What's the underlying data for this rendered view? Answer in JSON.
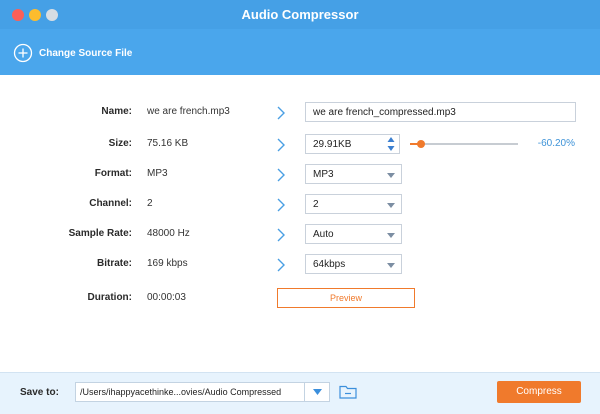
{
  "window": {
    "title": "Audio Compressor"
  },
  "toolbar": {
    "change_source_label": "Change Source File"
  },
  "colors": {
    "accent": "#45a0e6",
    "action": "#f07a2c"
  },
  "fields": {
    "name": {
      "label": "Name:",
      "original": "we are french.mp3",
      "output": "we are french_compressed.mp3"
    },
    "size": {
      "label": "Size:",
      "original": "75.16 KB",
      "output": "29.91KB",
      "percent": "-60.20%",
      "slider_fraction": 0.1
    },
    "format": {
      "label": "Format:",
      "original": "MP3",
      "selected": "MP3"
    },
    "channel": {
      "label": "Channel:",
      "original": "2",
      "selected": "2"
    },
    "sample_rate": {
      "label": "Sample Rate:",
      "original": "48000 Hz",
      "selected": "Auto"
    },
    "bitrate": {
      "label": "Bitrate:",
      "original": "169 kbps",
      "selected": "64kbps"
    },
    "duration": {
      "label": "Duration:",
      "value": "00:00:03",
      "preview_label": "Preview"
    }
  },
  "footer": {
    "save_to_label": "Save to:",
    "path": "/Users/ihappyacethinke...ovies/Audio Compressed",
    "compress_label": "Compress"
  }
}
